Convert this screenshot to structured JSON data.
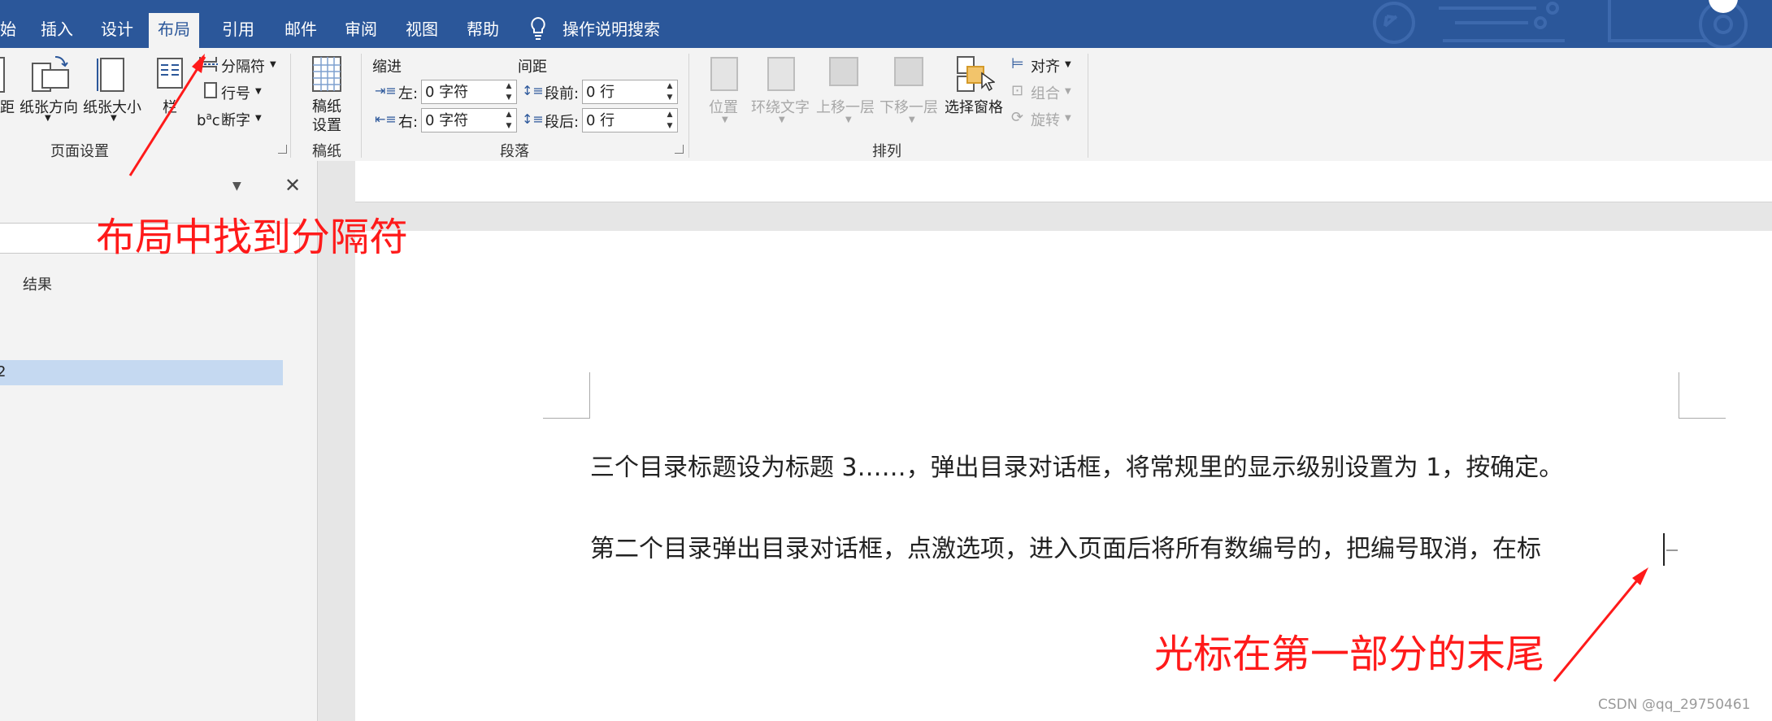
{
  "ribbon_tabs": [
    {
      "label": "始"
    },
    {
      "label": "插入"
    },
    {
      "label": "设计"
    },
    {
      "label": "布局"
    },
    {
      "label": "引用"
    },
    {
      "label": "邮件"
    },
    {
      "label": "审阅"
    },
    {
      "label": "视图"
    },
    {
      "label": "帮助"
    }
  ],
  "tell_me": "操作说明搜索",
  "page_setup": {
    "margins": "距",
    "orientation": "纸张方向",
    "size": "纸张大小",
    "columns": "栏",
    "breaks": "分隔符",
    "line_numbers": "行号",
    "hyphenation": "断字",
    "group_label": "页面设置"
  },
  "manuscript": {
    "button": "稿纸",
    "button2": "设置",
    "group_label": "稿纸"
  },
  "paragraph": {
    "indent_header": "缩进",
    "spacing_header": "间距",
    "left_label": "左:",
    "left_value": "0 字符",
    "right_label": "右:",
    "right_value": "0 字符",
    "before_label": "段前:",
    "before_value": "0 行",
    "after_label": "段后:",
    "after_value": "0 行",
    "group_label": "段落"
  },
  "arrange": {
    "position": "位置",
    "wrap_text": "环绕文字",
    "bring_forward": "上移一层",
    "send_backward": "下移一层",
    "selection_pane": "选择窗格",
    "align": "对齐",
    "group": "组合",
    "rotate": "旋转",
    "group_label": "排列"
  },
  "nav_pane": {
    "results_label": "结果",
    "highlight_text": "2"
  },
  "document": {
    "line1": "三个目录标题设为标题 3……，弹出目录对话框，将常规里的显示级别设置为 1，按确定。",
    "line2": "第二个目录弹出目录对话框，点激选项，进入页面后将所有数编号的，把编号取消，在标"
  },
  "annotations": {
    "find_breaks": "布局中找到分隔符",
    "cursor_note": "光标在第一部分的末尾"
  },
  "watermark": "CSDN @qq_29750461",
  "colors": {
    "title_blue": "#2b579a",
    "annotation_red": "#ff1a1a",
    "nav_highlight": "#c5d9f1"
  }
}
